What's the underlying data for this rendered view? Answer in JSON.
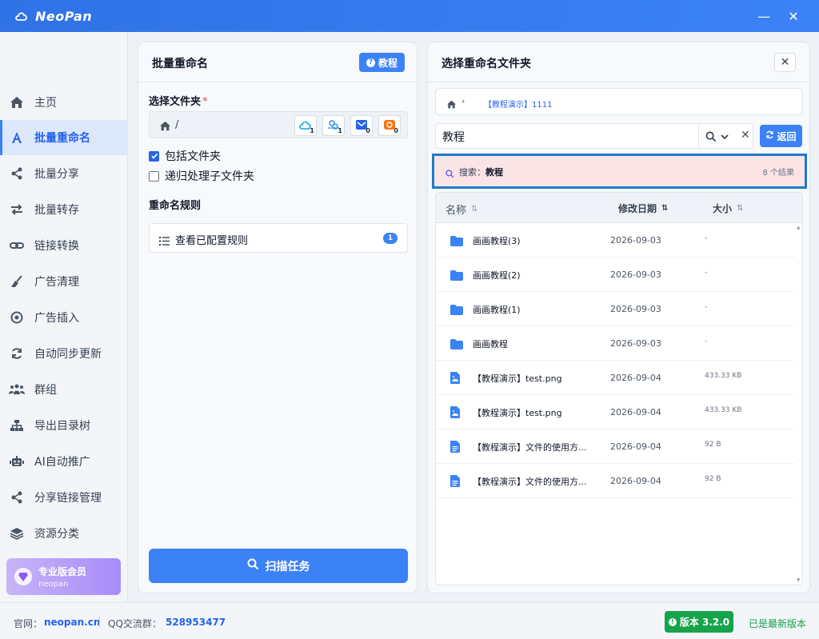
{
  "app": {
    "name": "NeoPan"
  },
  "window": {
    "minimize": "—",
    "close": "✕"
  },
  "sidebar": {
    "items": [
      {
        "label": "主页",
        "icon": "home-icon",
        "active": false
      },
      {
        "label": "批量重命名",
        "icon": "font-a-icon",
        "active": true
      },
      {
        "label": "批量分享",
        "icon": "share-icon",
        "active": false
      },
      {
        "label": "批量转存",
        "icon": "transfer-icon",
        "active": false
      },
      {
        "label": "链接转换",
        "icon": "link-icon",
        "active": false
      },
      {
        "label": "广告清理",
        "icon": "broom-icon",
        "active": false
      },
      {
        "label": "广告插入",
        "icon": "target-icon",
        "active": false
      },
      {
        "label": "自动同步更新",
        "icon": "sync-icon",
        "active": false
      },
      {
        "label": "群组",
        "icon": "users-icon",
        "active": false
      },
      {
        "label": "导出目录树",
        "icon": "sitemap-icon",
        "active": false
      },
      {
        "label": "AI自动推广",
        "icon": "robot-icon",
        "active": false
      },
      {
        "label": "分享链接管理",
        "icon": "share-icon",
        "active": false
      },
      {
        "label": "资源分类",
        "icon": "layers-icon",
        "active": false
      }
    ],
    "vip": {
      "title": "专业版会员",
      "subtitle": "neopan"
    }
  },
  "left_panel": {
    "title": "批量重命名",
    "tutorial_label": "教程",
    "folder_label": "选择文件夹",
    "required_mark": "*",
    "path": "/",
    "cloud_buttons": [
      {
        "icon": "cloud-icon",
        "sub": "1"
      },
      {
        "icon": "cloud-link-icon",
        "sub": "1"
      },
      {
        "icon": "mail-cloud-icon",
        "sub": "0"
      },
      {
        "icon": "uc-cloud-icon",
        "sub": "0"
      }
    ],
    "include_folders_label": "包括文件夹",
    "include_folders_checked": true,
    "recursive_label": "递归处理子文件夹",
    "recursive_checked": false,
    "rules_label": "重命名规则",
    "view_rules_label": "查看已配置规则",
    "rules_count": "1",
    "scan_label": "扫描任务"
  },
  "right_panel": {
    "title": "选择重命名文件夹",
    "close_label": "✕",
    "breadcrumb": "【教程演示】1111",
    "search_value": "教程",
    "back_label": "返回",
    "search_prefix": "搜索：",
    "search_term": "教程",
    "result_count": "8 个结果",
    "columns": {
      "name": "名称",
      "date": "修改日期",
      "size": "大小"
    },
    "files": [
      {
        "type": "folder",
        "name": "画画教程(3)",
        "date": "2026-09-03",
        "size": "-"
      },
      {
        "type": "folder",
        "name": "画画教程(2)",
        "date": "2026-09-03",
        "size": "-"
      },
      {
        "type": "folder",
        "name": "画画教程(1)",
        "date": "2026-09-03",
        "size": "-"
      },
      {
        "type": "folder",
        "name": "画画教程",
        "date": "2026-09-03",
        "size": "-"
      },
      {
        "type": "image",
        "name": "【教程演示】test.png",
        "date": "2026-09-04",
        "size": "433.33 KB"
      },
      {
        "type": "image",
        "name": "【教程演示】test.png",
        "date": "2026-09-04",
        "size": "433.33 KB"
      },
      {
        "type": "doc",
        "name": "【教程演示】文件的使用方...",
        "date": "2026-09-04",
        "size": "92 B"
      },
      {
        "type": "doc",
        "name": "【教程演示】文件的使用方...",
        "date": "2026-09-04",
        "size": "92 B"
      }
    ]
  },
  "footer": {
    "site_label": "官网：",
    "site": "neopan.cn",
    "qq_label": "QQ交流群：",
    "qq": "528953477",
    "version_label": "版本 3.2.0",
    "latest_label": "已是最新版本"
  },
  "colors": {
    "accent": "#3b82f6",
    "success": "#16a34a",
    "highlight_border": "#1e7bc7",
    "highlight_bg": "#fbe4e6"
  }
}
